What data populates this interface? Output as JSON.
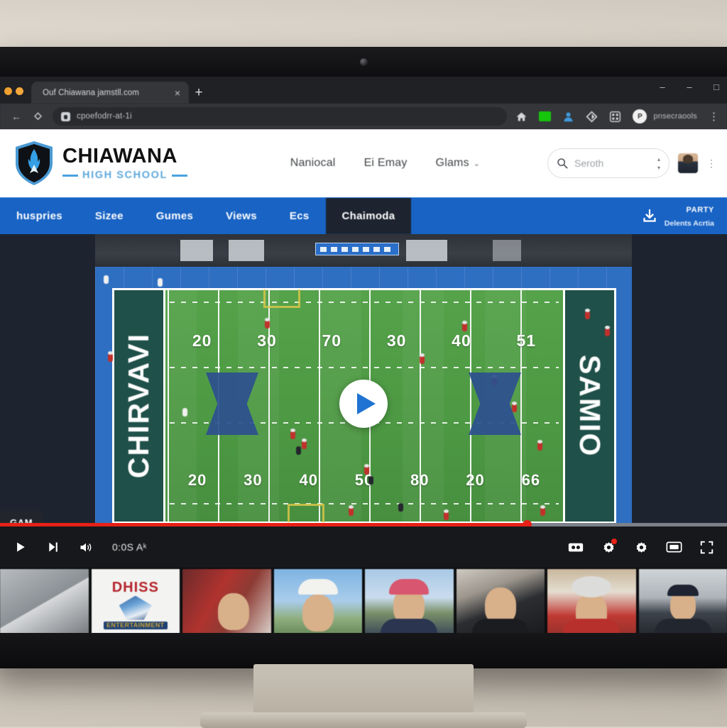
{
  "browser": {
    "tab": {
      "title": "Ouf Chiawana jamstll.com",
      "close_label": "×"
    },
    "new_tab_label": "+",
    "window_buttons": [
      "–",
      "–",
      "□"
    ],
    "nav": {
      "back": "←",
      "reload": "⟳"
    },
    "url": "cpoefodrr-at-1i",
    "toolbar": {
      "home": "home-icon",
      "extension": "extension-icon",
      "account": "account-icon",
      "shield": "shield-icon",
      "apps": "apps-grid-icon",
      "profile_initial": "P",
      "profile_name": "pnsecraools",
      "menu": "⋮"
    }
  },
  "site": {
    "logo": {
      "main": "CHIAWANA",
      "sub": "HIGH SCHOOL"
    },
    "nav": [
      {
        "label": "Naniocal",
        "has_caret": false
      },
      {
        "label": "Ei Emay",
        "has_caret": false
      },
      {
        "label": "Glams",
        "has_caret": true
      }
    ],
    "caret": "⌄",
    "search": {
      "placeholder": "Seroth",
      "icon": "search-icon"
    },
    "stepper": {
      "up": "▴",
      "down": "▾"
    },
    "header_menu": "⋮"
  },
  "bluebar": {
    "items": [
      {
        "label": "huspries",
        "active": false
      },
      {
        "label": "Sizee",
        "active": false
      },
      {
        "label": "Gumes",
        "active": false
      },
      {
        "label": "Views",
        "active": false
      },
      {
        "label": "Ecs",
        "active": false
      },
      {
        "label": "Chaimoda",
        "active": true
      }
    ],
    "cta": {
      "icon": "download-icon",
      "line1": "PARTY",
      "line2": "Delents Acrtia"
    }
  },
  "video": {
    "badge": "GAM",
    "play_button": "play-icon",
    "field": {
      "endzone_left": "CHIRVAVI",
      "endzone_right": "SAMIO",
      "yard_numbers_top": [
        "20",
        "30",
        "70",
        "30",
        "40",
        "51"
      ],
      "yard_numbers_bottom": [
        "20",
        "30",
        "40",
        "50",
        "80",
        "20",
        "66"
      ]
    },
    "controls": {
      "play": "play-icon",
      "next": "next-track-icon",
      "volume": "volume-icon",
      "time": "0:0S Aᵏ",
      "captions": "captions-icon",
      "settings_alert": "settings-alert-icon",
      "settings": "settings-icon",
      "miniplayer": "miniplayer-icon",
      "fullscreen": "fullscreen-icon"
    },
    "progress": {
      "played_percent": 72.5
    }
  },
  "thumbnails": [
    {
      "name": "thumb-vehicle",
      "class": "t1",
      "label": ""
    },
    {
      "name": "thumb-dhiss-logo",
      "class": "t2",
      "top": "DHISS",
      "bottom": "ENTERTAINMENT"
    },
    {
      "name": "thumb-boy-red-bear",
      "class": "t3",
      "label": ""
    },
    {
      "name": "thumb-helmet-player",
      "class": "t4",
      "label": ""
    },
    {
      "name": "thumb-man-pink-cap",
      "class": "t5",
      "label": ""
    },
    {
      "name": "thumb-man-dark-shirt",
      "class": "t6",
      "label": ""
    },
    {
      "name": "thumb-man-grey-wig",
      "class": "t7",
      "label": ""
    },
    {
      "name": "thumb-man-cap-outdoors",
      "class": "t8",
      "label": ""
    }
  ],
  "colors": {
    "brand_blue": "#1863c4",
    "dark_navy": "#1d2430",
    "logo_blue": "#5fa9dd",
    "progress_red": "#e62117",
    "field_green": "#55a24a",
    "endzone_green": "#1f5049"
  }
}
